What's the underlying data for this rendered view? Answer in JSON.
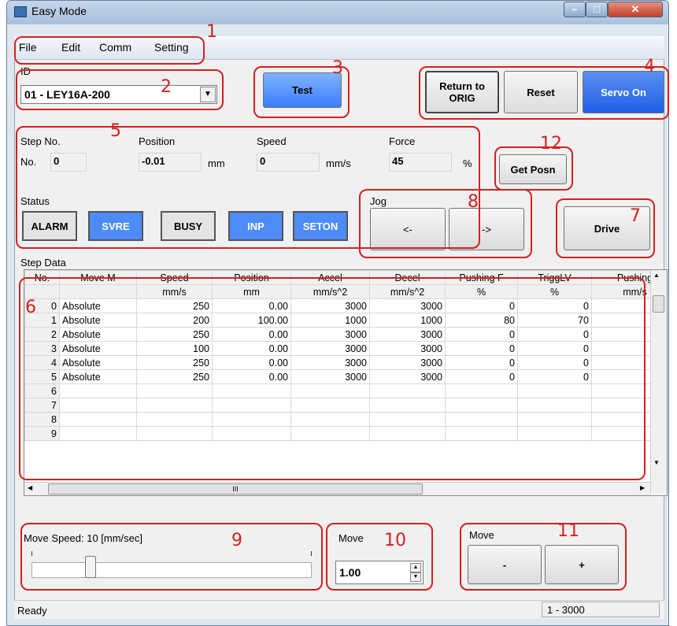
{
  "window": {
    "title": "Easy Mode"
  },
  "menu": [
    "File",
    "Edit",
    "Comm",
    "Setting"
  ],
  "id_select": {
    "label": "ID",
    "value": "01 - LEY16A-200"
  },
  "buttons": {
    "test": "Test",
    "return_to_orig": "Return to\nORIG",
    "reset": "Reset",
    "servo_on": "Servo On",
    "get_posn": "Get Posn",
    "drive": "Drive",
    "jog_left": "<-",
    "jog_right": "->",
    "move_minus": "-",
    "move_plus": "+"
  },
  "monitor": {
    "step_label": "Step No.",
    "no_label": "No.",
    "step_value": "0",
    "position_label": "Position",
    "position_value": "-0.01",
    "position_unit": "mm",
    "speed_label": "Speed",
    "speed_value": "0",
    "speed_unit": "mm/s",
    "force_label": "Force",
    "force_value": "45",
    "force_unit": "%"
  },
  "status": {
    "label": "Status",
    "items": [
      "ALARM",
      "SVRE",
      "BUSY",
      "INP",
      "SETON"
    ]
  },
  "jog": {
    "label": "Jog"
  },
  "step_data": {
    "label": "Step Data",
    "headers": [
      "No.",
      "Move M",
      "Speed",
      "Position",
      "Accel",
      "Decel",
      "Pushing F",
      "TriggLV",
      "Pushing"
    ],
    "units": [
      "",
      "",
      "mm/s",
      "mm",
      "mm/s^2",
      "mm/s^2",
      "%",
      "%",
      "mm/s"
    ],
    "rows": [
      [
        "0",
        "Absolute",
        "250",
        "0.00",
        "3000",
        "3000",
        "0",
        "0",
        ""
      ],
      [
        "1",
        "Absolute",
        "200",
        "100.00",
        "1000",
        "1000",
        "80",
        "70",
        ""
      ],
      [
        "2",
        "Absolute",
        "250",
        "0.00",
        "3000",
        "3000",
        "0",
        "0",
        ""
      ],
      [
        "3",
        "Absolute",
        "100",
        "0.00",
        "3000",
        "3000",
        "0",
        "0",
        ""
      ],
      [
        "4",
        "Absolute",
        "250",
        "0.00",
        "3000",
        "3000",
        "0",
        "0",
        ""
      ],
      [
        "5",
        "Absolute",
        "250",
        "0.00",
        "3000",
        "3000",
        "0",
        "0",
        ""
      ],
      [
        "6",
        "",
        "",
        "",
        "",
        "",
        "",
        "",
        ""
      ],
      [
        "7",
        "",
        "",
        "",
        "",
        "",
        "",
        "",
        ""
      ],
      [
        "8",
        "",
        "",
        "",
        "",
        "",
        "",
        "",
        ""
      ],
      [
        "9",
        "",
        "",
        "",
        "",
        "",
        "",
        "",
        ""
      ]
    ],
    "scroll_mark": "III"
  },
  "move_speed": {
    "label": "Move Speed:  10 [mm/sec]",
    "value_fraction": 0.2
  },
  "move_amount": {
    "label": "Move",
    "value": "1.00"
  },
  "move_pm": {
    "label": "Move"
  },
  "statusbar": {
    "left": "Ready",
    "right": "1 - 3000"
  },
  "annotations": [
    "1",
    "2",
    "3",
    "4",
    "5",
    "6",
    "7",
    "8",
    "9",
    "10",
    "11",
    "12"
  ]
}
